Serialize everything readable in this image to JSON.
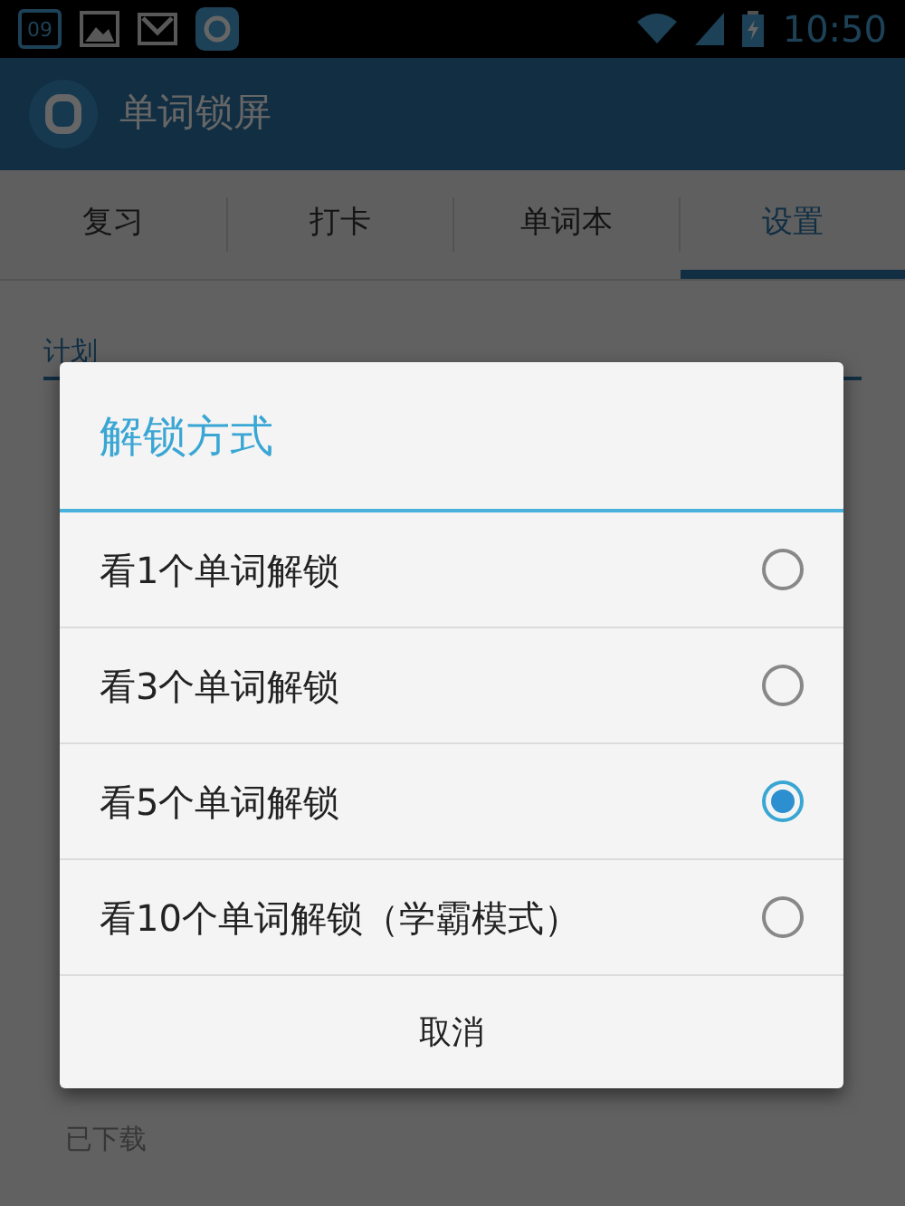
{
  "status_bar": {
    "calendar_day": "09",
    "time": "10:50"
  },
  "app_bar": {
    "title": "单词锁屏"
  },
  "tabs": [
    {
      "label": "复习",
      "selected": false
    },
    {
      "label": "打卡",
      "selected": false
    },
    {
      "label": "单词本",
      "selected": false
    },
    {
      "label": "设置",
      "selected": true
    }
  ],
  "settings": {
    "section_header": "计划",
    "voice_pack_status": "已下载"
  },
  "dialog": {
    "title": "解锁方式",
    "options": [
      {
        "label": "看1个单词解锁",
        "selected": false
      },
      {
        "label": "看3个单词解锁",
        "selected": false
      },
      {
        "label": "看5个单词解锁",
        "selected": true
      },
      {
        "label": "看10个单词解锁（学霸模式）",
        "selected": false
      }
    ],
    "cancel": "取消"
  }
}
